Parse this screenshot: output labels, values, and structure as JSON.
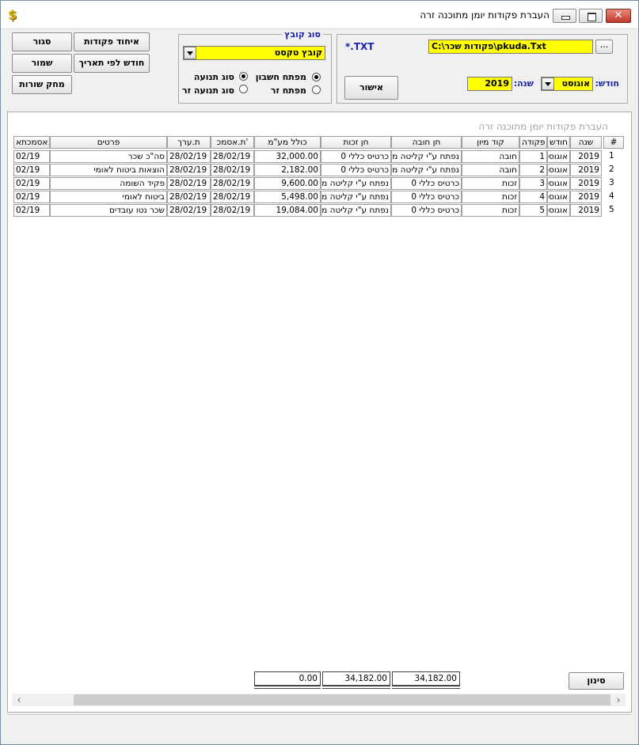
{
  "window": {
    "title": "העברת פקודות יומן מתוכנה זרה",
    "app_icon_glyph": "$",
    "close_glyph": "✕"
  },
  "buttons": {
    "close": "סגור",
    "merge": "איחוד פקודות",
    "save": "שמור",
    "month_by_date": "חודש לפי תאריך",
    "delete_rows": "מחק שורות",
    "confirm": "אישור",
    "filter": "סינון",
    "browse": "..."
  },
  "file_type": {
    "label": "סוג  קובץ",
    "value": "קובץ טקסט",
    "radios": {
      "account_key": "מפתח חשבון",
      "movement_type": "סוג תנועה",
      "foreign_key": "מפתח זר",
      "foreign_movement_type": "סוג תנועה זר"
    }
  },
  "file": {
    "extension_label": "*.TXT",
    "path": "C:\\פקודות שכר\\pkuda.Txt"
  },
  "period": {
    "month_label": "חודש:",
    "month_value": "אוגוסט",
    "year_label": "שנה:",
    "year_value": "2019"
  },
  "grid": {
    "caption": "העברת פקודות יומן מתוכנה זרה",
    "headers": {
      "num": "#",
      "year": "שנה",
      "month": "חודש",
      "order": "פקודה",
      "sort_code": "קוד מיון",
      "debit_acct": "חן חובה",
      "credit_acct": "חן זכות",
      "total": "כולל מע\"מ",
      "ref_date": "ת.אסמכ'",
      "value_date": "ת.ערך",
      "details": "פרטים",
      "reference": "אסמכתא"
    },
    "rows": [
      {
        "num": "1",
        "year": "2019",
        "month": "אוגוסט",
        "order": "1",
        "sort_code": "חובה",
        "debit_acct": "נפתח ע\"י קליטה מ",
        "credit_acct": "כרטיס כללי 0",
        "total": "32,000.00",
        "ref_date": "28/02/19",
        "value_date": "28/02/19",
        "details": "סה\"כ שכר",
        "reference": "02/19"
      },
      {
        "num": "2",
        "year": "2019",
        "month": "אוגוסט",
        "order": "2",
        "sort_code": "חובה",
        "debit_acct": "נפתח ע\"י קליטה מ",
        "credit_acct": "כרטיס כללי 0",
        "total": "2,182.00",
        "ref_date": "28/02/19",
        "value_date": "28/02/19",
        "details": "הוצאות ביטוח לאומי",
        "reference": "02/19"
      },
      {
        "num": "3",
        "year": "2019",
        "month": "אוגוסט",
        "order": "3",
        "sort_code": "זכות",
        "debit_acct": "כרטיס כללי 0",
        "credit_acct": "נפתח ע\"י קליטה מ",
        "total": "9,600.00",
        "ref_date": "28/02/19",
        "value_date": "28/02/19",
        "details": "פקיד השומה",
        "reference": "02/19"
      },
      {
        "num": "4",
        "year": "2019",
        "month": "אוגוסט",
        "order": "4",
        "sort_code": "זכות",
        "debit_acct": "כרטיס כללי 0",
        "credit_acct": "נפתח ע\"י קליטה מ",
        "total": "5,498.00",
        "ref_date": "28/02/19",
        "value_date": "28/02/19",
        "details": "ביטוח לאומי",
        "reference": "02/19"
      },
      {
        "num": "5",
        "year": "2019",
        "month": "אוגוסט",
        "order": "5",
        "sort_code": "זכות",
        "debit_acct": "כרטיס כללי 0",
        "credit_acct": "נפתח ע\"י קליטה מ",
        "total": "19,084.00",
        "ref_date": "28/02/19",
        "value_date": "28/02/19",
        "details": "שכר נטו עובדים",
        "reference": "02/19"
      }
    ],
    "totals": {
      "debit": "34,182.00",
      "credit": "34,182.00",
      "balance": "0.00"
    }
  }
}
